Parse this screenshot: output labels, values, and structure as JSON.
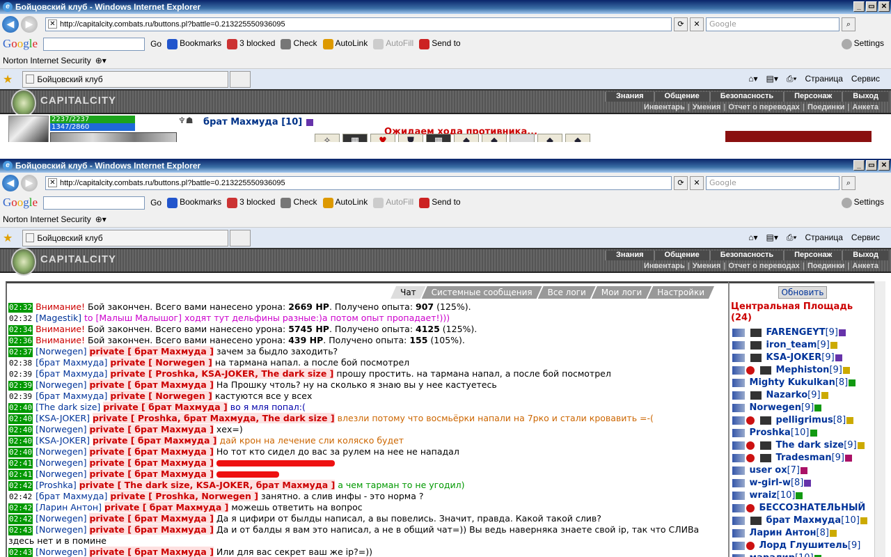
{
  "window": {
    "title": "Бойцовский клуб - Windows Internet Explorer",
    "url": "http://capitalcity.combats.ru/buttons.pl?battle=0.213225550936095",
    "search_placeholder": "Google",
    "minimize": "_",
    "maximize": "▭",
    "close": "✕"
  },
  "google_toolbar": {
    "logo": [
      "G",
      "o",
      "o",
      "g",
      "l",
      "e"
    ],
    "go": "Go",
    "bookmarks": "Bookmarks",
    "blocked": "3 blocked",
    "check": "Check",
    "autolink": "AutoLink",
    "autofill": "AutoFill",
    "sendto": "Send to",
    "settings": "Settings"
  },
  "norton": "Norton Internet Security",
  "tab": {
    "title": "Бойцовский клуб"
  },
  "ie_tools": {
    "page": "Страница",
    "service": "Сервис"
  },
  "game": {
    "brand": "CAPITALCITY",
    "menu_top": [
      "Знания",
      "Общение",
      "Безопасность",
      "Персонаж",
      "Выход"
    ],
    "menu_sub": [
      "Инвентарь",
      "Умения",
      "Отчет о переводах",
      "Поединки",
      "Анкета"
    ],
    "hp": "2237/2237",
    "mp": "1347/2860",
    "hp_fraction": 1.0,
    "mp_fraction": 0.47,
    "opponent": "брат Махмуда [10]",
    "waiting": "Ожидаем хода противника...",
    "cards": [
      "✧",
      "▦",
      "♥",
      "⛊",
      "▦",
      "◆",
      "◆",
      "",
      "◆",
      "◆"
    ]
  },
  "chat": {
    "tabs": [
      "Чат",
      "Системные сообщения",
      "Все логи",
      "Мои логи",
      "Настройки"
    ],
    "messages": [
      {
        "time": "02:32",
        "hl": true,
        "parts": [
          {
            "c": "warn",
            "t": "Внимание!"
          },
          {
            "c": "",
            "t": " Бой закончен. Всего вами нанесено урона: "
          },
          {
            "c": "b",
            "t": "2669 HP"
          },
          {
            "c": "",
            "t": ". Получено опыта: "
          },
          {
            "c": "b",
            "t": "907"
          },
          {
            "c": "",
            "t": " (125%)."
          }
        ]
      },
      {
        "time": "02:32",
        "hl": false,
        "parts": [
          {
            "c": "nick",
            "t": "[Magestik]"
          },
          {
            "c": "pink",
            "t": " to [Малыш Малышог] ходят тут дельфины разные:)а потом опыт пропадает!)))"
          }
        ]
      },
      {
        "time": "02:34",
        "hl": true,
        "parts": [
          {
            "c": "warn",
            "t": "Внимание!"
          },
          {
            "c": "",
            "t": " Бой закончен. Всего вами нанесено урона: "
          },
          {
            "c": "b",
            "t": "5745 HP"
          },
          {
            "c": "",
            "t": ". Получено опыта: "
          },
          {
            "c": "b",
            "t": "4125"
          },
          {
            "c": "",
            "t": " (125%)."
          }
        ]
      },
      {
        "time": "02:36",
        "hl": true,
        "parts": [
          {
            "c": "warn",
            "t": "Внимание!"
          },
          {
            "c": "",
            "t": " Бой закончен. Всего вами нанесено урона: "
          },
          {
            "c": "b",
            "t": "439 HP"
          },
          {
            "c": "",
            "t": ". Получено опыта: "
          },
          {
            "c": "b",
            "t": "155"
          },
          {
            "c": "",
            "t": " (105%)."
          }
        ]
      },
      {
        "time": "02:37",
        "hl": true,
        "parts": [
          {
            "c": "nick",
            "t": "[Norwegen]"
          },
          {
            "c": "",
            "t": " "
          },
          {
            "c": "pv",
            "t": "private [ брат Махмуда ]"
          },
          {
            "c": "",
            "t": " зачем за быдло заходить?"
          }
        ]
      },
      {
        "time": "02:38",
        "hl": false,
        "parts": [
          {
            "c": "nick",
            "t": "[брат Махмуда]"
          },
          {
            "c": "",
            "t": " "
          },
          {
            "c": "pv",
            "t": "private [ Norwegen ]"
          },
          {
            "c": "",
            "t": " на тармана напал. а после бой посмотрел"
          }
        ]
      },
      {
        "time": "02:39",
        "hl": false,
        "parts": [
          {
            "c": "nick",
            "t": "[брат Махмуда]"
          },
          {
            "c": "",
            "t": " "
          },
          {
            "c": "pv",
            "t": "private [ Proshka, KSA-JOKER, The dark size ]"
          },
          {
            "c": "",
            "t": " прошу простить. на тармана напал, а после бой посмотрел"
          }
        ]
      },
      {
        "time": "02:39",
        "hl": true,
        "parts": [
          {
            "c": "nick",
            "t": "[Norwegen]"
          },
          {
            "c": "",
            "t": " "
          },
          {
            "c": "pv",
            "t": "private [ брат Махмуда ]"
          },
          {
            "c": "",
            "t": " На Прошку чтоль? ну на сколько я знаю вы у нее кастуетесь"
          }
        ]
      },
      {
        "time": "02:39",
        "hl": false,
        "parts": [
          {
            "c": "nick",
            "t": "[брат Махмуда]"
          },
          {
            "c": "",
            "t": " "
          },
          {
            "c": "pv",
            "t": "private [ Norwegen ]"
          },
          {
            "c": "",
            "t": " кастуются все у всех"
          }
        ]
      },
      {
        "time": "02:40",
        "hl": true,
        "parts": [
          {
            "c": "nick",
            "t": "[The dark size]"
          },
          {
            "c": "",
            "t": " "
          },
          {
            "c": "pv",
            "t": "private [ брат Махмуда ]"
          },
          {
            "c": "blue",
            "t": " во я мля попал:("
          }
        ]
      },
      {
        "time": "02:40",
        "hl": true,
        "parts": [
          {
            "c": "nick",
            "t": "[KSA-JOKER]"
          },
          {
            "c": "",
            "t": " "
          },
          {
            "c": "pv",
            "t": "private [ Proshka, брат Махмуда, The dark size ]"
          },
          {
            "c": "orange",
            "t": " влезли потому что восмьёрки напали на 7рко и стали кровавить =-("
          }
        ]
      },
      {
        "time": "02:40",
        "hl": true,
        "parts": [
          {
            "c": "nick",
            "t": "[Norwegen]"
          },
          {
            "c": "",
            "t": " "
          },
          {
            "c": "pv",
            "t": "private [ брат Махмуда ]"
          },
          {
            "c": "",
            "t": " хех=)"
          }
        ]
      },
      {
        "time": "02:40",
        "hl": true,
        "parts": [
          {
            "c": "nick",
            "t": "[KSA-JOKER]"
          },
          {
            "c": "",
            "t": " "
          },
          {
            "c": "pv",
            "t": "private [ брат Махмуда ]"
          },
          {
            "c": "orange",
            "t": " дай крон на лечение сли коляско будет"
          }
        ]
      },
      {
        "time": "02:40",
        "hl": true,
        "parts": [
          {
            "c": "nick",
            "t": "[Norwegen]"
          },
          {
            "c": "",
            "t": " "
          },
          {
            "c": "pv",
            "t": "private [ брат Махмуда ]"
          },
          {
            "c": "",
            "t": " Но тот кто сидел до вас за рулем на нее не нападал"
          }
        ]
      },
      {
        "time": "02:41",
        "hl": true,
        "scribble": "s1",
        "parts": [
          {
            "c": "nick",
            "t": "[Norwegen]"
          },
          {
            "c": "",
            "t": " "
          },
          {
            "c": "pv",
            "t": "private [ брат Махмуда ]"
          },
          {
            "c": "",
            "t": " "
          }
        ]
      },
      {
        "time": "02:41",
        "hl": true,
        "scribble": "s2",
        "parts": [
          {
            "c": "nick",
            "t": "[Norwegen]"
          },
          {
            "c": "",
            "t": " "
          },
          {
            "c": "pv",
            "t": "private [ брат Махмуда ]"
          },
          {
            "c": "",
            "t": " "
          }
        ]
      },
      {
        "time": "02:42",
        "hl": true,
        "parts": [
          {
            "c": "nick",
            "t": "[Proshka]"
          },
          {
            "c": "",
            "t": " "
          },
          {
            "c": "pv",
            "t": "private [ The dark size, KSA-JOKER, брат Махмуда ]"
          },
          {
            "c": "green",
            "t": " а чем тарман то не угодил)"
          }
        ]
      },
      {
        "time": "02:42",
        "hl": false,
        "parts": [
          {
            "c": "nick",
            "t": "[брат Махмуда]"
          },
          {
            "c": "",
            "t": " "
          },
          {
            "c": "pv",
            "t": "private [ Proshka, Norwegen ]"
          },
          {
            "c": "",
            "t": " занятно. а слив инфы - это норма ?"
          }
        ]
      },
      {
        "time": "02:42",
        "hl": true,
        "parts": [
          {
            "c": "nick",
            "t": "[Ларин Антон]"
          },
          {
            "c": "",
            "t": " "
          },
          {
            "c": "pv",
            "t": "private [ брат Махмуда ]"
          },
          {
            "c": "",
            "t": " можешь ответить на вопрос"
          }
        ]
      },
      {
        "time": "02:42",
        "hl": true,
        "parts": [
          {
            "c": "nick",
            "t": "[Norwegen]"
          },
          {
            "c": "",
            "t": " "
          },
          {
            "c": "pv",
            "t": "private [ брат Махмуда ]"
          },
          {
            "c": "",
            "t": " Да я цифири от былды написал, а вы повелись. Значит, правда. Какой такой слив?"
          }
        ]
      },
      {
        "time": "02:43",
        "hl": true,
        "wrap": true,
        "parts": [
          {
            "c": "nick",
            "t": "[Norwegen]"
          },
          {
            "c": "",
            "t": " "
          },
          {
            "c": "pv",
            "t": "private [ брат Махмуда ]"
          },
          {
            "c": "",
            "t": " Да и от балды я вам это написал, а не в общий чат=)) Вы ведь наверняка знаете свой ip, так что СЛИВа здесь нет и в помине"
          }
        ]
      },
      {
        "time": "02:43",
        "hl": true,
        "parts": [
          {
            "c": "nick",
            "t": "[Norwegen]"
          },
          {
            "c": "",
            "t": " "
          },
          {
            "c": "pv",
            "t": "private [ брат Махмуда ]"
          },
          {
            "c": "",
            "t": " Или для вас секрет ваш же ip?=))"
          }
        ]
      }
    ]
  },
  "sidebar": {
    "refresh": "Обновить",
    "room": "Центральная Площадь (24)",
    "users": [
      {
        "name": "FARENGEYT",
        "level": "[9]",
        "clan": true,
        "inf": "v"
      },
      {
        "name": "iron_team",
        "level": "[9]",
        "clan": true,
        "inf": "y"
      },
      {
        "name": "KSA-JOKER",
        "level": "[9]",
        "clan": true,
        "inf": "v"
      },
      {
        "name": "Mephiston",
        "level": "[9]",
        "clan": true,
        "red": true,
        "inf": "y"
      },
      {
        "name": "Mighty Kukulkan",
        "level": "[8]",
        "inf": "g"
      },
      {
        "name": "Nazarko",
        "level": "[9]",
        "clan": true,
        "inf": "y"
      },
      {
        "name": "Norwegen",
        "level": "[9]",
        "inf": "g"
      },
      {
        "name": "pelligrimus",
        "level": "[8]",
        "clan": true,
        "red": true,
        "inf": "y"
      },
      {
        "name": "Proshka",
        "level": "[10]",
        "inf": "g"
      },
      {
        "name": "The dark size",
        "level": "[9]",
        "clan": true,
        "red": true,
        "inf": "y"
      },
      {
        "name": "Tradesman",
        "level": "[9]",
        "clan": true,
        "red": true,
        "inf": "m"
      },
      {
        "name": "user ox",
        "level": "[7]",
        "inf": "m"
      },
      {
        "name": "w-girl-w",
        "level": "[8]",
        "inf": "v"
      },
      {
        "name": "wraiz",
        "level": "[10]",
        "inf": "g"
      },
      {
        "name": "БЕССОЗНАТЕЛЬНЫЙ",
        "level": "",
        "red": true,
        "inf": ""
      },
      {
        "name": "брат Махмуда",
        "level": "[10]",
        "clan": true,
        "inf": "y"
      },
      {
        "name": "Ларин Антон",
        "level": "[8]",
        "inf": "y"
      },
      {
        "name": "Лорд Глушитель",
        "level": "[9]",
        "red": true,
        "inf": ""
      },
      {
        "name": "маралир",
        "level": "[10]",
        "inf": "g"
      }
    ]
  },
  "colors": {
    "time_bg": "#009900",
    "private": "#cc0000",
    "nick": "#003399"
  }
}
